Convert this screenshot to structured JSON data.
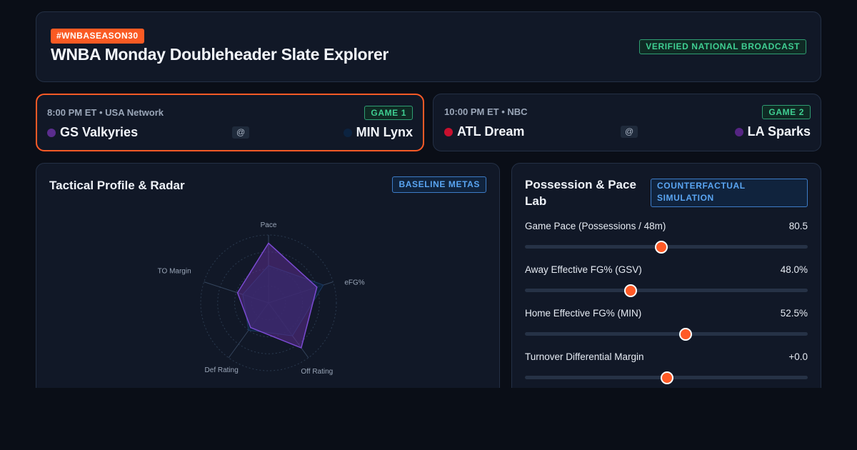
{
  "header": {
    "hashtag": "#WNBASEASON30",
    "title": "WNBA Monday Doubleheader Slate Explorer",
    "verified": "VERIFIED NATIONAL BROADCAST"
  },
  "games": [
    {
      "meta": "8:00 PM ET • USA Network",
      "badge": "GAME 1",
      "selected": true,
      "away": {
        "name": "GS Valkyries",
        "color": "#5b2d8e"
      },
      "at": "@",
      "home": {
        "name": "MIN Lynx",
        "color": "#0c2340"
      }
    },
    {
      "meta": "10:00 PM ET • NBC",
      "badge": "GAME 2",
      "selected": false,
      "away": {
        "name": "ATL Dream",
        "color": "#c8102e"
      },
      "at": "@",
      "home": {
        "name": "LA Sparks",
        "color": "#552583"
      }
    }
  ],
  "radar": {
    "title": "Tactical Profile & Radar",
    "badge": "BASELINE METAS",
    "axes": [
      "Pace",
      "eFG%",
      "Off Rating",
      "Def Rating",
      "TO Margin"
    ],
    "series": [
      {
        "color": "#0c2340",
        "values": [
          0.55,
          0.85,
          0.6,
          0.5,
          0.4
        ]
      },
      {
        "color": "#5b2d8e",
        "values": [
          0.88,
          0.75,
          0.82,
          0.45,
          0.48
        ]
      }
    ]
  },
  "lab": {
    "title": "Possession & Pace Lab",
    "badge": "COUNTERFACTUAL SIMULATION",
    "sliders": [
      {
        "label": "Game Pace (Possessions / 48m)",
        "value": "80.5",
        "fraction": 0.48
      },
      {
        "label": "Away Effective FG% (GSV)",
        "value": "48.0%",
        "fraction": 0.37
      },
      {
        "label": "Home Effective FG% (MIN)",
        "value": "52.5%",
        "fraction": 0.565
      },
      {
        "label": "Turnover Differential Margin",
        "value": "+0.0",
        "fraction": 0.5
      }
    ]
  },
  "colors": {
    "accent": "#fa5a23",
    "success": "#3fcf92",
    "info": "#5aa5f2"
  }
}
